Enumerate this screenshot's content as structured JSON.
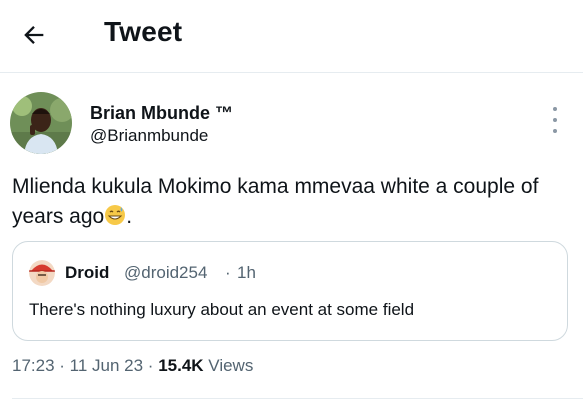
{
  "header": {
    "back_icon": "arrow-left-icon",
    "title": "Tweet"
  },
  "tweet": {
    "author_name": "Brian Mbunde ™",
    "author_handle": "@Brianmbunde",
    "text": "Mlienda kukula Mokimo kama mmevaa white a couple of years ago",
    "text_suffix": ".",
    "emoji": "grinning-sweat-emoji",
    "more_icon": "more-vertical-icon"
  },
  "quote": {
    "author_name": "Droid",
    "author_handle": "@droid254",
    "separator": "·",
    "time": "1h",
    "text": "There's nothing luxury about an event at some field"
  },
  "meta": {
    "time": "17:23",
    "sep1": " · ",
    "date": "11 Jun 23",
    "sep2": " · ",
    "views_count": "15.4K",
    "views_label": " Views"
  },
  "colors": {
    "text": "#0f1419",
    "secondary": "#536471",
    "border": "#cfd9de"
  }
}
